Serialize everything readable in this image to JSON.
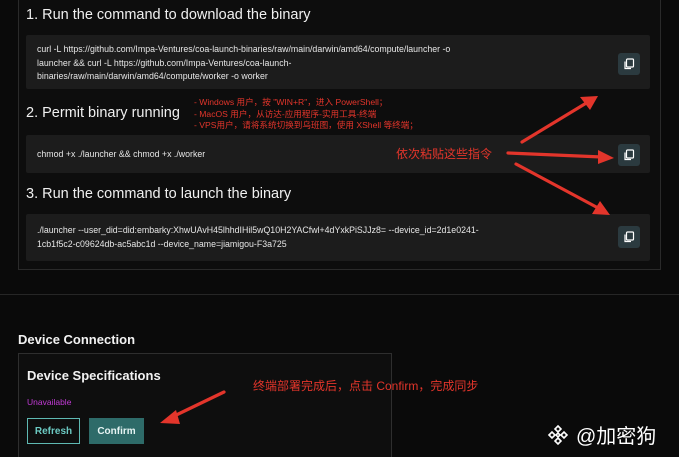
{
  "steps": [
    {
      "title": "1. Run the command to download the binary",
      "command_lines": [
        "curl -L https://github.com/Impa-Ventures/coa-launch-binaries/raw/main/darwin/amd64/compute/launcher -o",
        "launcher && curl -L https://github.com/Impa-Ventures/coa-launch-",
        "binaries/raw/main/darwin/amd64/compute/worker -o worker"
      ]
    },
    {
      "title": "2. Permit binary running",
      "command_lines": [
        "chmod +x ./launcher && chmod +x ./worker"
      ]
    },
    {
      "title": "3. Run the command to launch the binary",
      "command_lines": [
        "./launcher --user_did=did:embarky:XhwUAvH45lhhdIHil5wQ10H2YACfwl+4dYxkPiSJJz8= --device_id=2d1e0241-",
        "1cb1f5c2-c09624db-ac5abc1d --device_name=jiamigou-F3a725"
      ]
    }
  ],
  "annotations": {
    "os_notes": [
      "- Windows 用户，按 \"WIN+R\"，进入 PowerShell；",
      "- MacOS 用户，从访达-应用程序-实用工具-终端",
      "- VPS用户，请将系统切换到乌班图，使用 XShell 等终端；"
    ],
    "paste_hint": "依次粘贴这些指令",
    "confirm_hint": "终端部署完成后，点击 Confirm，完成同步",
    "color": "#e3352b"
  },
  "device_connection": {
    "section_title": "Device Connection",
    "card_title": "Device Specifications",
    "status": "Unavailable",
    "refresh_label": "Refresh",
    "confirm_label": "Confirm"
  },
  "watermark": {
    "text": "@加密狗"
  },
  "colors": {
    "accent": "#2e6b69",
    "accent_outline": "#5fb9b3",
    "unavailable": "#c23ad6"
  }
}
